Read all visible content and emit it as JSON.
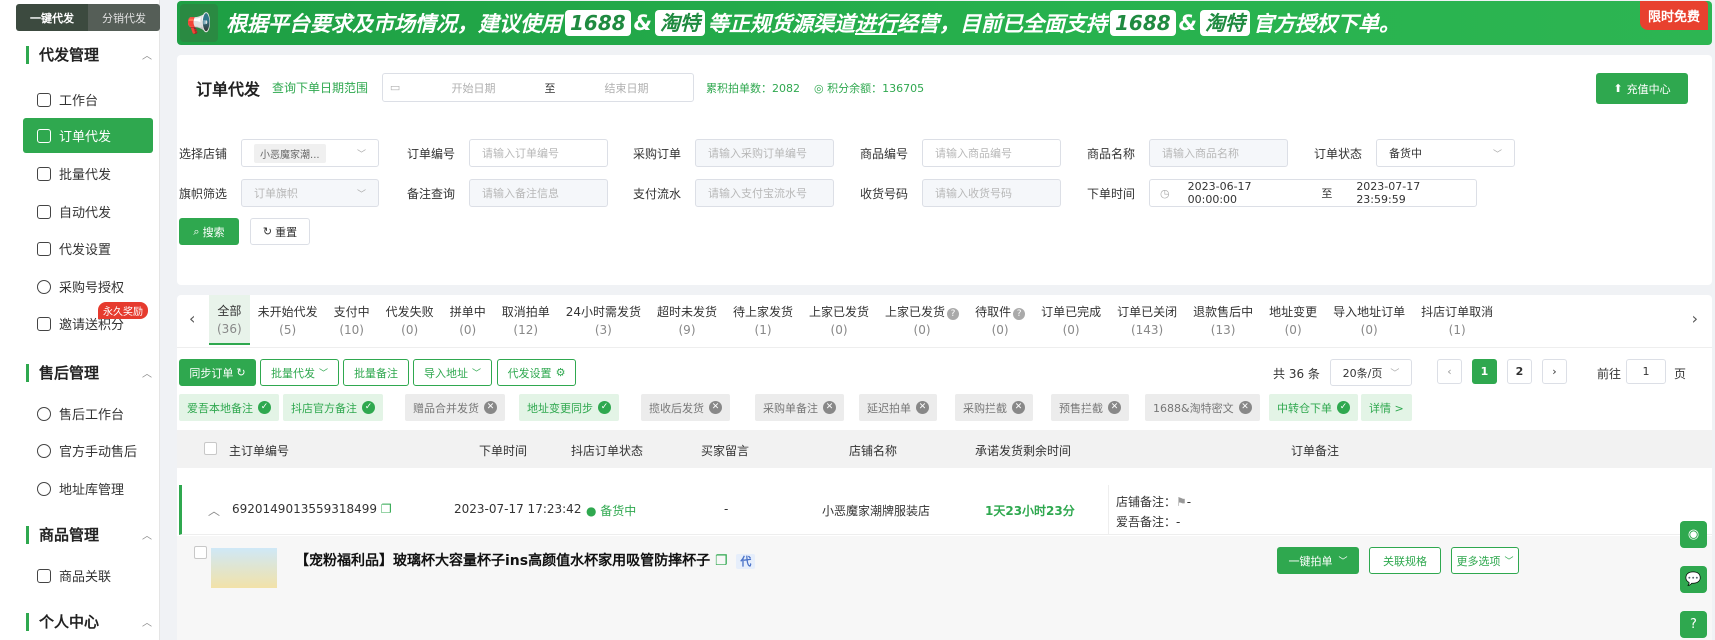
{
  "top_toggle": {
    "left": "一键代发",
    "right": "分销代发"
  },
  "sidebar": {
    "sections": [
      {
        "title": "代发管理",
        "items": [
          "工作台",
          "订单代发",
          "批量代发",
          "自动代发",
          "代发设置",
          "采购号授权",
          "邀请送积分"
        ]
      },
      {
        "title": "售后管理",
        "items": [
          "售后工作台",
          "官方手动售后",
          "地址库管理"
        ]
      },
      {
        "title": "商品管理",
        "items": [
          "商品关联"
        ]
      },
      {
        "title": "个人中心",
        "items": []
      }
    ],
    "badge": "永久奖励"
  },
  "banner": {
    "part1": "根据平台要求及市场情况，建议使用",
    "tag1": "1688",
    "amp1": "&",
    "tag2": "淘特",
    "part2": "等正规货源渠道",
    "part2b": "进行",
    "part2c": "经营，目前已全面支持",
    "tag3": "1688",
    "amp2": "&",
    "tag4": "淘特",
    "part3": "官方授权下单。",
    "promo": "限时免费"
  },
  "header": {
    "title": "订单代发",
    "range_link": "查询下单日期范围",
    "start_placeholder": "开始日期",
    "to": "至",
    "end_placeholder": "结束日期",
    "stat1": "累积拍单数：2082",
    "stat2": "积分余额：136705",
    "recharge": "充值中心"
  },
  "filters": {
    "shop_label": "选择店铺",
    "shop_value": "小恶魔家潮...",
    "order_no_label": "订单编号",
    "order_no_ph": "请输入订单编号",
    "purchase_label": "采购订单",
    "purchase_ph": "请输入采购订单编号",
    "goods_no_label": "商品编号",
    "goods_no_ph": "请输入商品编号",
    "goods_name_label": "商品名称",
    "goods_name_ph": "请输入商品名称",
    "status_label": "订单状态",
    "status_value": "备货中",
    "flag_label": "旗帜筛选",
    "flag_ph": "订单旗帜",
    "remark_label": "备注查询",
    "remark_ph": "请输入备注信息",
    "pay_label": "支付流水",
    "pay_ph": "请输入支付宝流水号",
    "recv_label": "收货号码",
    "recv_ph": "请输入收货号码",
    "time_label": "下单时间",
    "time_start": "2023-06-17 00:00:00",
    "time_to": "至",
    "time_end": "2023-07-17 23:59:59",
    "search_btn": "搜索",
    "reset_btn": "重置"
  },
  "tabs": [
    {
      "label": "全部",
      "count": "(36)"
    },
    {
      "label": "未开始代发",
      "count": "(5)"
    },
    {
      "label": "支付中",
      "count": "(10)"
    },
    {
      "label": "代发失败",
      "count": "(0)"
    },
    {
      "label": "拼单中",
      "count": "(0)"
    },
    {
      "label": "取消拍单",
      "count": "(12)"
    },
    {
      "label": "24小时需发货",
      "count": "(3)"
    },
    {
      "label": "超时未发货",
      "count": "(9)"
    },
    {
      "label": "待上家发货",
      "count": "(1)"
    },
    {
      "label": "上家已发货",
      "count": "(0)"
    },
    {
      "label": "上家已发货",
      "count": "(0)"
    },
    {
      "label": "待取件",
      "count": "(0)"
    },
    {
      "label": "订单已完成",
      "count": "(0)"
    },
    {
      "label": "订单已关闭",
      "count": "(143)"
    },
    {
      "label": "退款售后中",
      "count": "(13)"
    },
    {
      "label": "地址变更",
      "count": "(0)"
    },
    {
      "label": "导入地址订单",
      "count": "(0)"
    },
    {
      "label": "抖店订单取消",
      "count": "(1)"
    }
  ],
  "toolbar": {
    "sync": "同步订单",
    "batch": "批量代发",
    "batch_remark": "批量备注",
    "import": "导入地址",
    "settings": "代发设置",
    "total": "共 36 条",
    "page_size": "20条/页",
    "page1": "1",
    "page2": "2",
    "goto": "前往",
    "goto_val": "1",
    "page_unit": "页"
  },
  "chips": [
    {
      "label": "爱吾本地备注",
      "on": true
    },
    {
      "label": "抖店官方备注",
      "on": true
    },
    {
      "label": "赠品合并发货",
      "on": false
    },
    {
      "label": "地址变更同步",
      "on": true
    },
    {
      "label": "揽收后发货",
      "on": false
    },
    {
      "label": "采购单备注",
      "on": false
    },
    {
      "label": "延迟拍单",
      "on": false
    },
    {
      "label": "采购拦截",
      "on": false
    },
    {
      "label": "预售拦截",
      "on": false
    },
    {
      "label": "1688&淘特密文",
      "on": false
    },
    {
      "label": "中转仓下单",
      "on": true
    },
    {
      "label": "详情 >",
      "on": true
    }
  ],
  "table": {
    "headers": [
      "主订单编号",
      "下单时间",
      "抖店订单状态",
      "买家留言",
      "店铺名称",
      "承诺发货剩余时间",
      "订单备注"
    ],
    "row": {
      "order_no": "6920149013559318499",
      "time": "2023-07-17 17:23:42",
      "status": "备货中",
      "message": "-",
      "shop": "小恶魔家潮牌服装店",
      "remaining": "1天23小时23分",
      "remark1": "店铺备注：",
      "remark1_val": "-",
      "remark2": "爱吾备注：",
      "remark2_val": "-"
    },
    "product": {
      "title": "【宠粉福利品】玻璃杯大容量杯子ins高颜值水杯家用吸管防摔杯子",
      "tag": "代",
      "btn1": "一键拍单",
      "btn2": "关联规格",
      "btn3": "更多选项"
    }
  }
}
